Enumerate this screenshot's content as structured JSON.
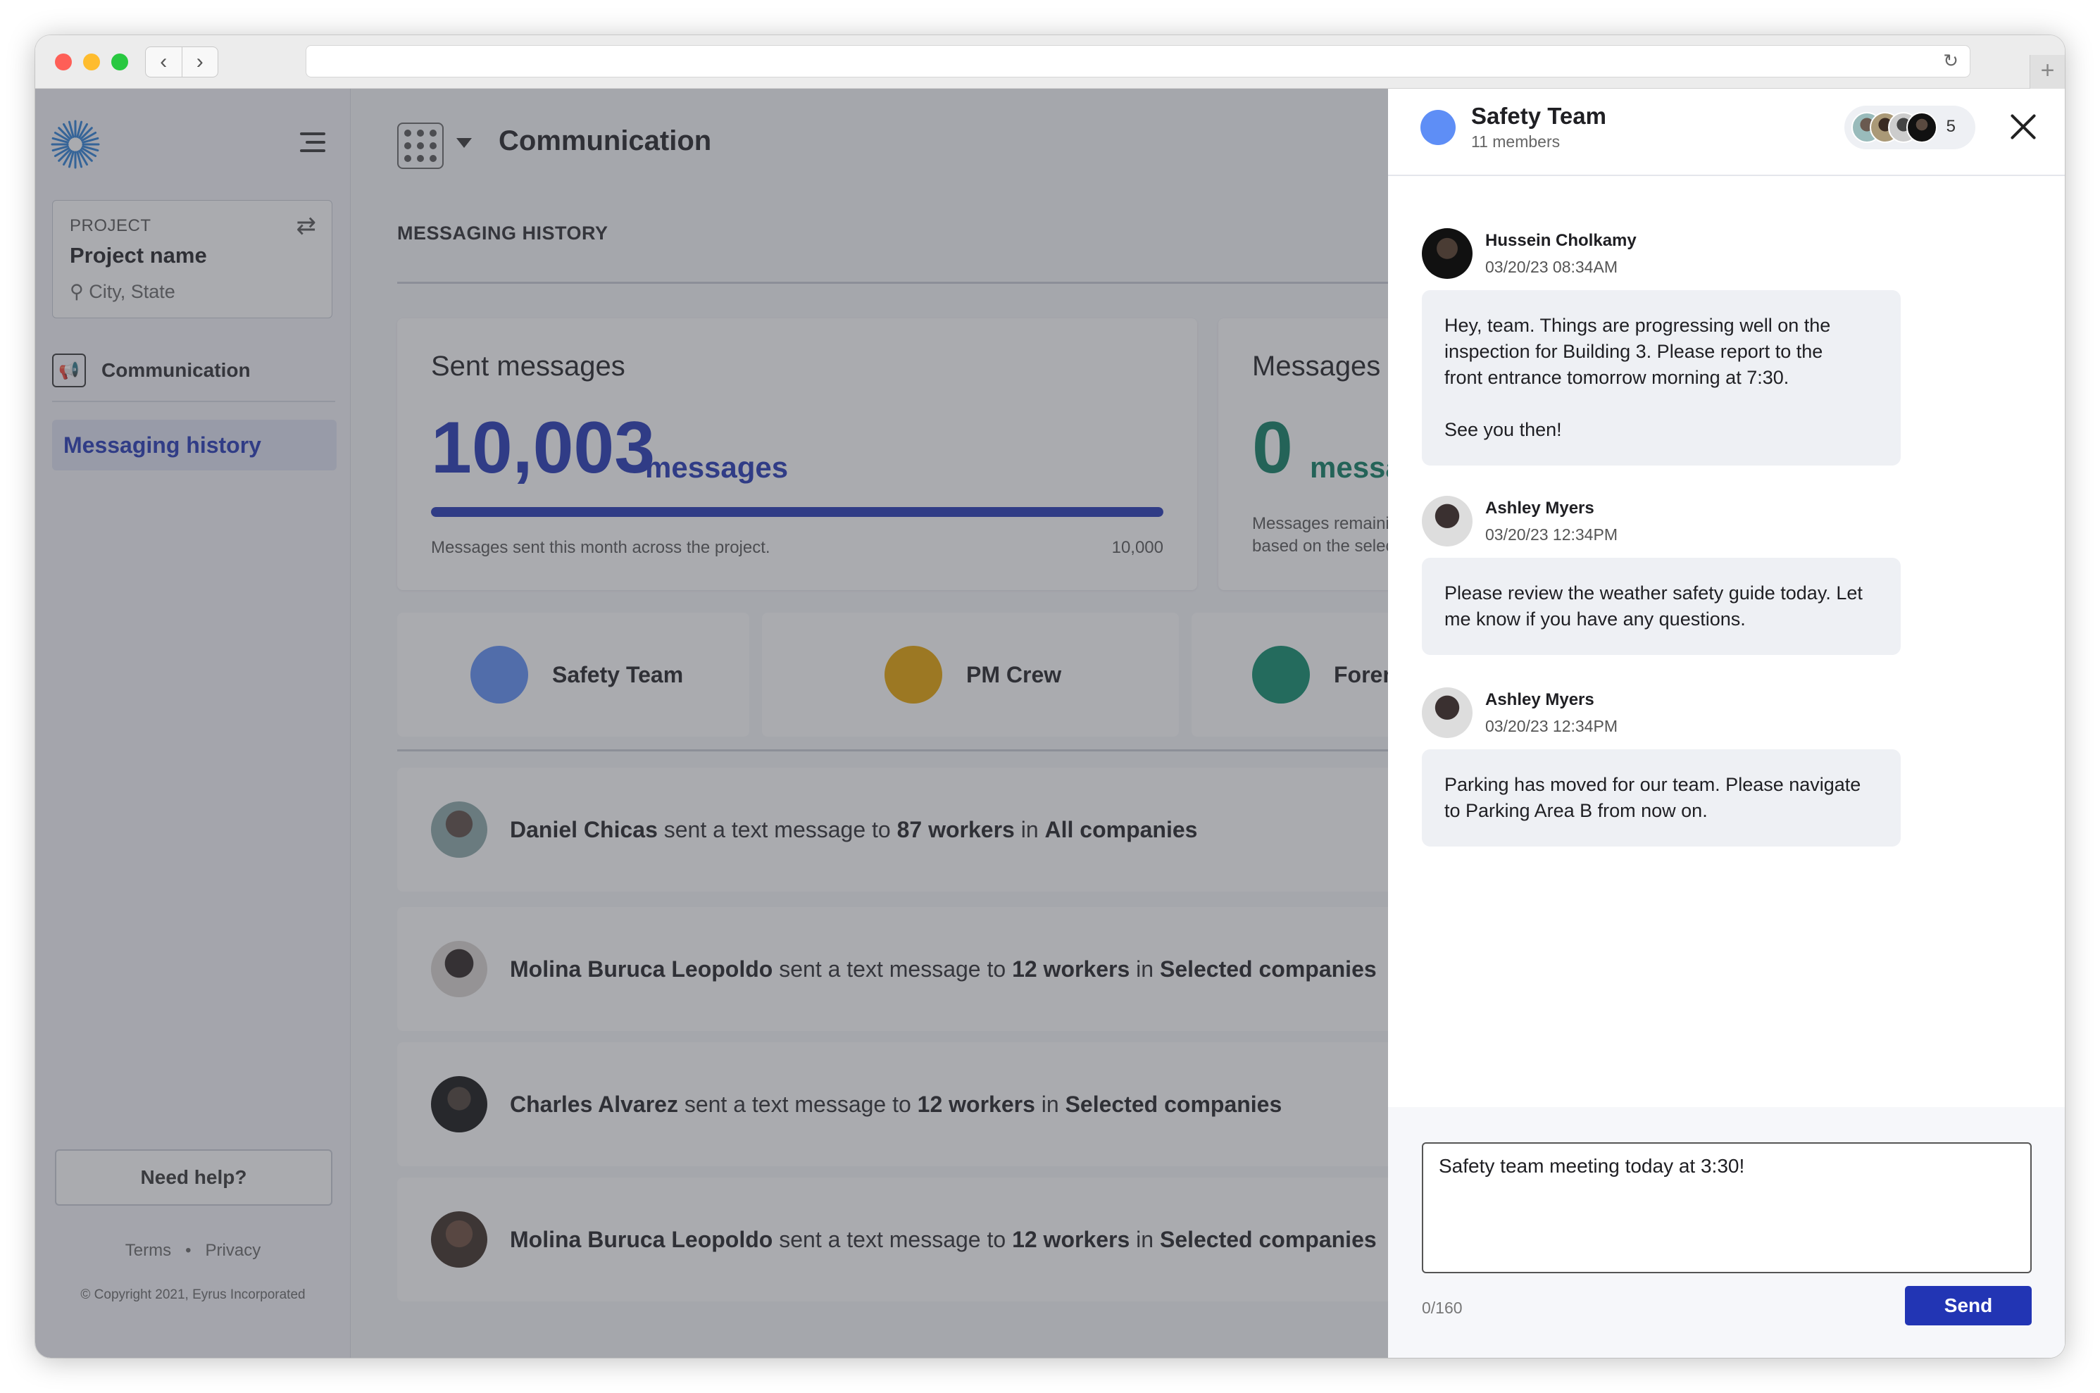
{
  "browser": {
    "url": ""
  },
  "sidebar": {
    "project_label": "PROJECT",
    "project_name": "Project name",
    "project_location": "City, State",
    "nav_section": "Communication",
    "nav_active": "Messaging history",
    "help_button": "Need help?",
    "terms": "Terms",
    "privacy": "Privacy",
    "legal_separator": "•",
    "copyright": "© Copyright 2021, Eyrus Incorporated"
  },
  "header": {
    "title": "Communication"
  },
  "main": {
    "section_title": "MESSAGING HISTORY",
    "sent_card": {
      "title": "Sent messages",
      "count": "10,003",
      "unit": "messages",
      "progress_fraction": 1.0,
      "note": "Messages sent this month across the project.",
      "limit": "10,000",
      "accent": "#2235b4"
    },
    "remaining_card": {
      "title": "Messages remaining",
      "count": "0",
      "unit": "messages",
      "note_line1": "Messages remaining",
      "note_line2": "based on the selected",
      "accent": "#0b7d62"
    },
    "groups": [
      {
        "name": "Safety Team",
        "color": "#5e8ef6"
      },
      {
        "name": "PM Crew",
        "color": "#e6a300"
      },
      {
        "name": "Foremen",
        "color": "#0b8a6a"
      }
    ],
    "history": [
      {
        "sender": "Daniel Chicas",
        "mid": " sent a text message to ",
        "workers": "87 workers",
        "in": " in ",
        "companies": "All companies"
      },
      {
        "sender": "Molina Buruca Leopoldo",
        "mid": " sent a text message to ",
        "workers": "12 workers",
        "in": " in ",
        "companies": "Selected companies"
      },
      {
        "sender": "Charles Alvarez",
        "mid": " sent a text message to ",
        "workers": "12 workers",
        "in": " in ",
        "companies": "Selected companies"
      },
      {
        "sender": "Molina Buruca Leopoldo",
        "mid": " sent a text message to ",
        "workers": "12 workers",
        "in": " in ",
        "companies": "Selected companies"
      }
    ]
  },
  "drawer": {
    "group_name": "Safety Team",
    "member_count": "11 members",
    "avatar_overflow": "5",
    "messages": [
      {
        "author": "Hussein Cholkamy",
        "time": "03/20/23 08:34AM",
        "text": "Hey, team. Things are progressing well on the\ninspection for Building 3. Please report to the\nfront entrance tomorrow morning at 7:30.\n\nSee you then!"
      },
      {
        "author": "Ashley Myers",
        "time": "03/20/23 12:34PM",
        "text": "Please review the weather safety guide today. Let\nme know if you have any questions."
      },
      {
        "author": "Ashley Myers",
        "time": "03/20/23 12:34PM",
        "text": "Parking has moved for our team. Please navigate\nto Parking Area B from now on."
      }
    ],
    "compose_value": "Safety team meeting today at 3:30!",
    "char_counter": "0/160",
    "send_label": "Send"
  }
}
